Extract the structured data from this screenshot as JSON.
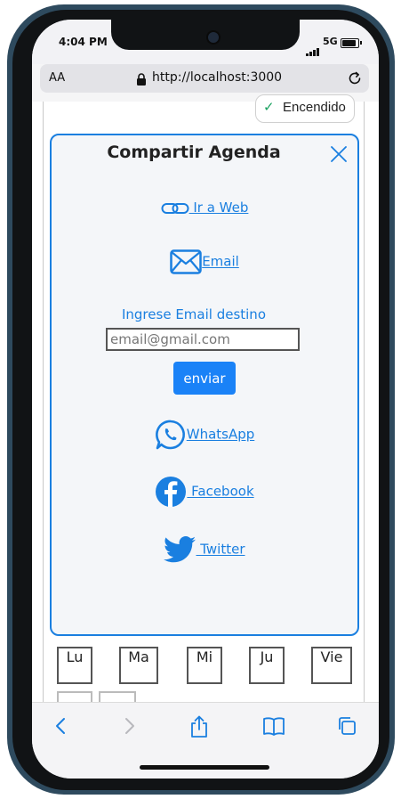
{
  "status_bar": {
    "time": "4:04 PM",
    "network": "5G"
  },
  "browser": {
    "text_size_label": "AA",
    "url": "http://localhost:3000"
  },
  "toggle": {
    "label": "Encendido"
  },
  "share_modal": {
    "title": "Compartir Agenda",
    "web_link_label": " Ir a Web",
    "email_link_label": "Email",
    "email_prompt": "Ingrese Email destino",
    "email_input": {
      "value": "",
      "placeholder": "email@gmail.com"
    },
    "send_label": "enviar",
    "whatsapp_label": "WhatsApp",
    "facebook_label": " Facebook",
    "twitter_label": " Twitter"
  },
  "days": [
    "Lu",
    "Ma",
    "Mi",
    "Ju",
    "Vie"
  ],
  "colors": {
    "accent": "#1a7fe0",
    "button": "#1a82f7"
  },
  "icons": [
    "link-icon",
    "envelope-icon",
    "whatsapp-icon",
    "facebook-icon",
    "twitter-icon",
    "close-icon"
  ]
}
